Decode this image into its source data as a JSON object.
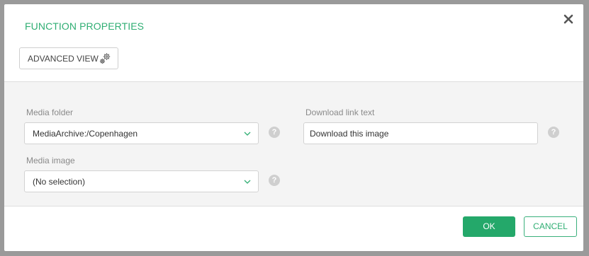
{
  "dialog": {
    "title": "FUNCTION PROPERTIES",
    "close_icon": "close-icon"
  },
  "toolbar": {
    "advanced_view_label": "ADVANCED VIEW",
    "advanced_view_icon": "gears-icon"
  },
  "fields": {
    "media_folder": {
      "label": "Media folder",
      "value": "MediaArchive:/Copenhagen",
      "help": "?"
    },
    "media_image": {
      "label": "Media image",
      "value": "(No selection)",
      "help": "?"
    },
    "download_link_text": {
      "label": "Download link text",
      "value": "Download this image",
      "help": "?"
    }
  },
  "footer": {
    "ok_label": "OK",
    "cancel_label": "CANCEL"
  },
  "colors": {
    "accent": "#2fae73",
    "ok_background": "#24a86a"
  }
}
